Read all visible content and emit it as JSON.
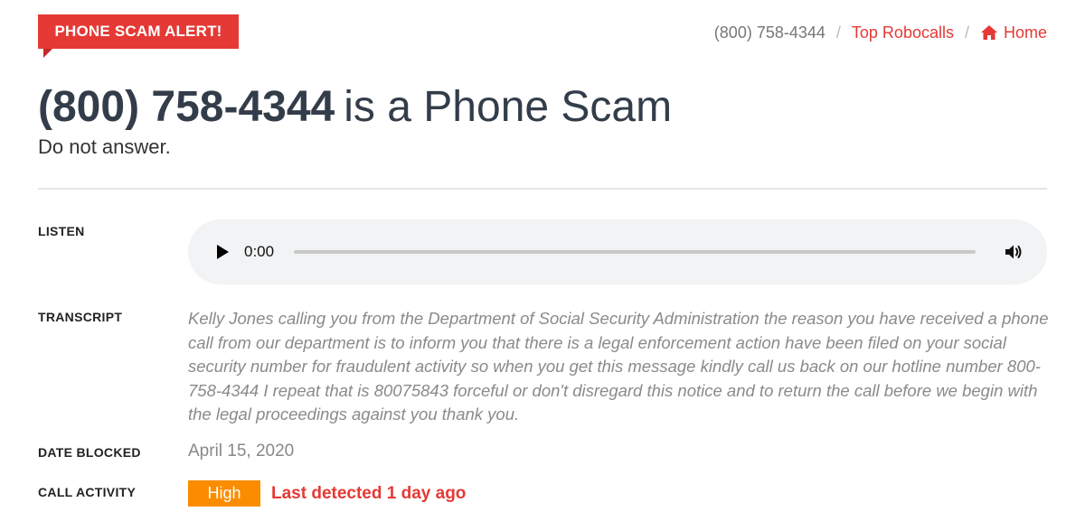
{
  "alert": {
    "label": "PHONE SCAM ALERT!"
  },
  "breadcrumb": {
    "number": "(800) 758-4344",
    "separator": "/",
    "top_robocalls": "Top Robocalls",
    "home": "Home"
  },
  "header": {
    "number": "(800) 758-4344",
    "title_rest": "is a Phone Scam",
    "subtitle": "Do not answer."
  },
  "listen": {
    "label": "LISTEN",
    "time": "0:00"
  },
  "transcript": {
    "label": "TRANSCRIPT",
    "text": "Kelly Jones calling you from the Department of Social Security Administration the reason you have received a phone call from our department is to inform you that there is a legal enforcement action have been filed on your social security number for fraudulent activity so when you get this message kindly call us back on our hotline number 800-758-4344 I repeat that is 80075843 forceful or don't disregard this notice and to return the call before we begin with the legal proceedings against you thank you."
  },
  "date_blocked": {
    "label": "DATE BLOCKED",
    "value": "April 15, 2020"
  },
  "call_activity": {
    "label": "CALL ACTIVITY",
    "level": "High",
    "detected": "Last detected 1 day ago"
  },
  "icons": {
    "home": "home-icon",
    "play": "play-icon",
    "volume": "volume-icon"
  },
  "colors": {
    "accent_red": "#e53935",
    "badge_orange": "#fb8c00",
    "heading": "#333d4a"
  }
}
